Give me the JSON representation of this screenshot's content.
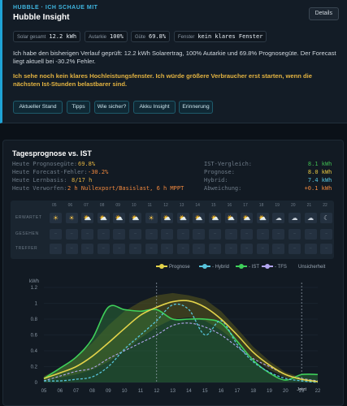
{
  "header": {
    "kicker": "HUBBLE · ICH SCHAUE MIT",
    "title": "Hubble Insight",
    "details_label": "Details"
  },
  "chips": [
    {
      "label": "Solar gesamt",
      "value": "12.2 kWh"
    },
    {
      "label": "Autarkie",
      "value": "100%"
    },
    {
      "label": "Güte",
      "value": "69.8%"
    },
    {
      "label": "Fenster",
      "value": "kein klares Fenster"
    }
  ],
  "insight_text": "Ich habe den bisherigen Verlauf geprüft: 12.2 kWh Solarertrag, 100% Autarkie und 69.8% Prognosegüte. Der Forecast liegt aktuell bei -30.2% Fehler.",
  "insight_warning": "Ich sehe noch kein klares Hochleistungsfenster. Ich würde größere Verbraucher erst starten, wenn die nächsten Ist-Stunden belastbarer sind.",
  "actions": [
    "Aktueller Stand",
    "Tipps",
    "Wie sicher?",
    "Akku Insight",
    "Erinnerung"
  ],
  "forecast": {
    "title": "Tagesprognose vs. IST",
    "left_stats": [
      {
        "label": "Heute Prognosegüte:",
        "value": "69.8%",
        "color": "#e3b341"
      },
      {
        "label": "Heute Forecast-Fehler:",
        "value": "-30.2%",
        "color": "#f0883e"
      },
      {
        "label": "Heute Lernbasis:",
        "value": "8/17 h",
        "color": "#e3b341"
      },
      {
        "label": "Heute Verworfen:",
        "value": "2 h Nullexport/Basislast, 6 h MPPT",
        "color": "#f0883e"
      }
    ],
    "right_stats": [
      {
        "label": "IST-Vergleich:",
        "value": "8.1 kWh",
        "color": "#3fb950"
      },
      {
        "label": "Prognose:",
        "value": "8.0 kWh",
        "color": "#e3c341"
      },
      {
        "label": "Hybrid:",
        "value": "7.4 kWh",
        "color": "#58c4dc"
      },
      {
        "label": "Abweichung:",
        "value": "+0.1 kWh",
        "color": "#f0883e"
      }
    ],
    "timeline": {
      "hours": [
        "05",
        "06",
        "07",
        "08",
        "09",
        "10",
        "11",
        "12",
        "13",
        "14",
        "15",
        "16",
        "17",
        "18",
        "19",
        "20",
        "21",
        "22"
      ],
      "rows": [
        "ERWARTET",
        "GESEHEN",
        "TREFFER"
      ],
      "expected_icons": [
        "sun",
        "sun",
        "sun-cloud",
        "sun-cloud",
        "sun-cloud",
        "sun-cloud",
        "sun",
        "sun-cloud",
        "sun-cloud",
        "sun-cloud",
        "sun-cloud",
        "sun-cloud",
        "sun-cloud",
        "sun-cloud",
        "cloud",
        "cloud",
        "cloud",
        "moon-cloud"
      ]
    }
  },
  "chart_data": {
    "type": "line",
    "ylabel": "kWh",
    "ylim": [
      0,
      1.2
    ],
    "yticks": [
      "0",
      "0.2",
      "0.4",
      "0.6",
      "0.8",
      "1",
      "1.2"
    ],
    "x": [
      "05",
      "06",
      "07",
      "08",
      "09",
      "10",
      "11",
      "12",
      "13",
      "14",
      "15",
      "16",
      "17",
      "18",
      "19",
      "20",
      "21",
      "22"
    ],
    "legend": [
      "Prognose",
      "Hybrid",
      "IST",
      "TFS"
    ],
    "annotations": [
      "Unsicherheit",
      "Jetzt"
    ],
    "colors": {
      "Prognose": "#e3d34a",
      "Hybrid": "#58c4dc",
      "IST": "#3fd05a",
      "TFS": "#b3a6f0",
      "band": "#5a5a1e"
    },
    "series": [
      {
        "name": "Prognose",
        "values": [
          0.05,
          0.12,
          0.2,
          0.33,
          0.5,
          0.68,
          0.85,
          0.95,
          1.02,
          1.03,
          0.95,
          0.8,
          0.6,
          0.38,
          0.22,
          0.1,
          0.04,
          0.01
        ]
      },
      {
        "name": "Hybrid",
        "values": [
          0.02,
          0.02,
          0.04,
          0.07,
          0.2,
          0.42,
          0.6,
          0.78,
          0.98,
          0.92,
          0.6,
          0.78,
          0.48,
          0.26,
          0.13,
          0.05,
          0.02,
          0.0
        ]
      },
      {
        "name": "IST",
        "values": [
          0.05,
          0.18,
          0.32,
          0.55,
          0.95,
          0.92,
          0.9,
          0.92,
          0.8,
          0.8,
          0.8,
          0.75,
          0.52,
          0.28,
          0.12,
          0.03,
          0.1,
          0.1
        ]
      },
      {
        "name": "TFS",
        "values": [
          0.02,
          0.08,
          0.14,
          0.18,
          0.3,
          0.4,
          0.5,
          0.6,
          0.72,
          0.75,
          0.7,
          0.6,
          0.45,
          0.3,
          0.2,
          0.1,
          0.05,
          0.02
        ]
      }
    ],
    "band_upper": [
      0.08,
      0.18,
      0.32,
      0.5,
      0.72,
      0.9,
      1.02,
      1.1,
      1.13,
      1.1,
      1.05,
      0.9,
      0.68,
      0.45,
      0.27,
      0.13,
      0.06,
      0.02
    ],
    "band_lower": [
      0.02,
      0.06,
      0.1,
      0.16,
      0.26,
      0.4,
      0.56,
      0.7,
      0.8,
      0.82,
      0.78,
      0.66,
      0.5,
      0.3,
      0.16,
      0.06,
      0.02,
      0.0
    ],
    "markers": [
      {
        "x": "12",
        "label": ""
      },
      {
        "x": "21",
        "label": "Jetzt"
      }
    ]
  }
}
